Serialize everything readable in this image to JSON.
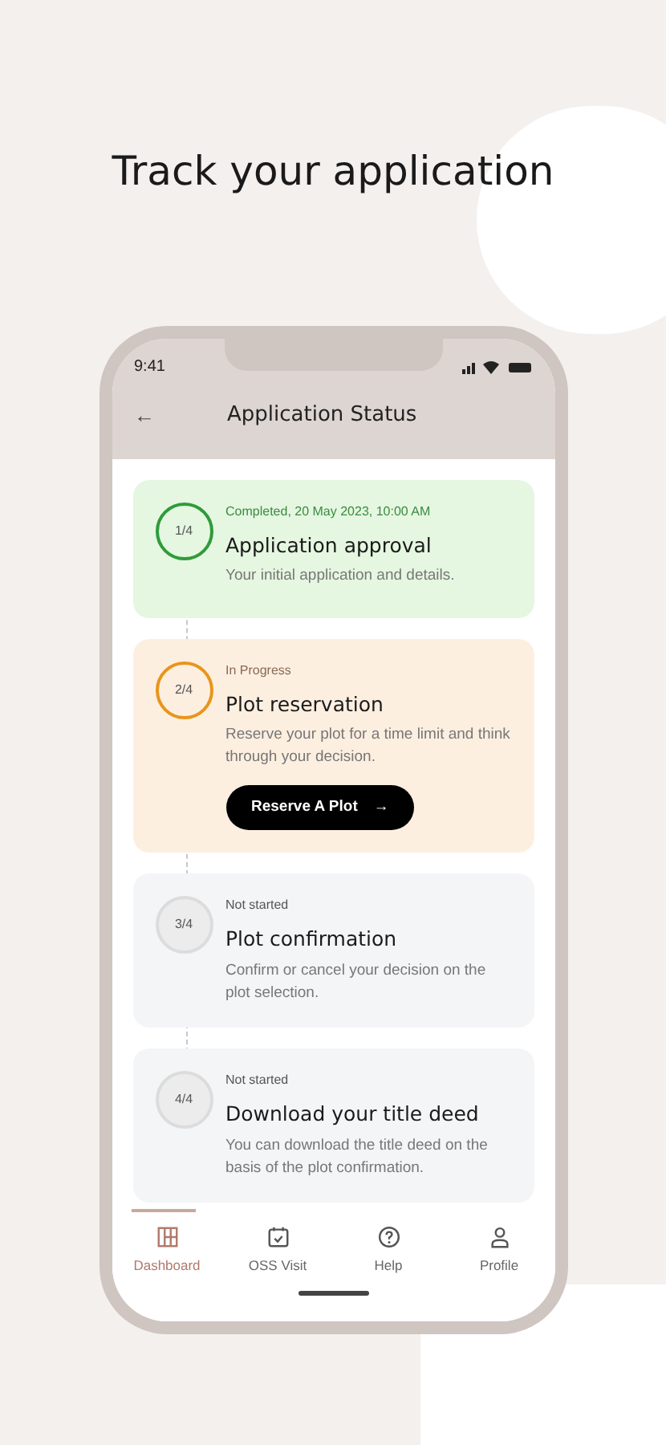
{
  "headline": "Track your application",
  "status_bar": {
    "time": "9:41"
  },
  "header": {
    "back": "←",
    "title": "Application Status"
  },
  "steps": [
    {
      "kind": "completed",
      "number": "1/4",
      "status": "Completed,  20 May 2023, 10:00 AM",
      "title": "Application approval",
      "description": "Your initial application and details."
    },
    {
      "kind": "in_progress",
      "number": "2/4",
      "status": "In Progress",
      "title": "Plot reservation",
      "description": "Reserve your plot for a time limit and think through your decision.",
      "button": "Reserve A Plot",
      "button_icon": "→"
    },
    {
      "kind": "not_started",
      "number": "3/4",
      "status": "Not started",
      "title": "Plot confirmation",
      "description": "Confirm or cancel your decision on the plot selection."
    },
    {
      "kind": "not_started",
      "number": "4/4",
      "status": "Not started",
      "title": "Download your title deed",
      "description": "You can download the title deed on the basis of the plot confirmation."
    }
  ],
  "nav": [
    {
      "label": "Dashboard",
      "kind": "dashboard",
      "selected": true
    },
    {
      "label": "OSS Visit",
      "kind": "calendar",
      "selected": false
    },
    {
      "label": "Help",
      "kind": "help",
      "selected": false
    },
    {
      "label": "Profile",
      "kind": "profile",
      "selected": false
    }
  ]
}
